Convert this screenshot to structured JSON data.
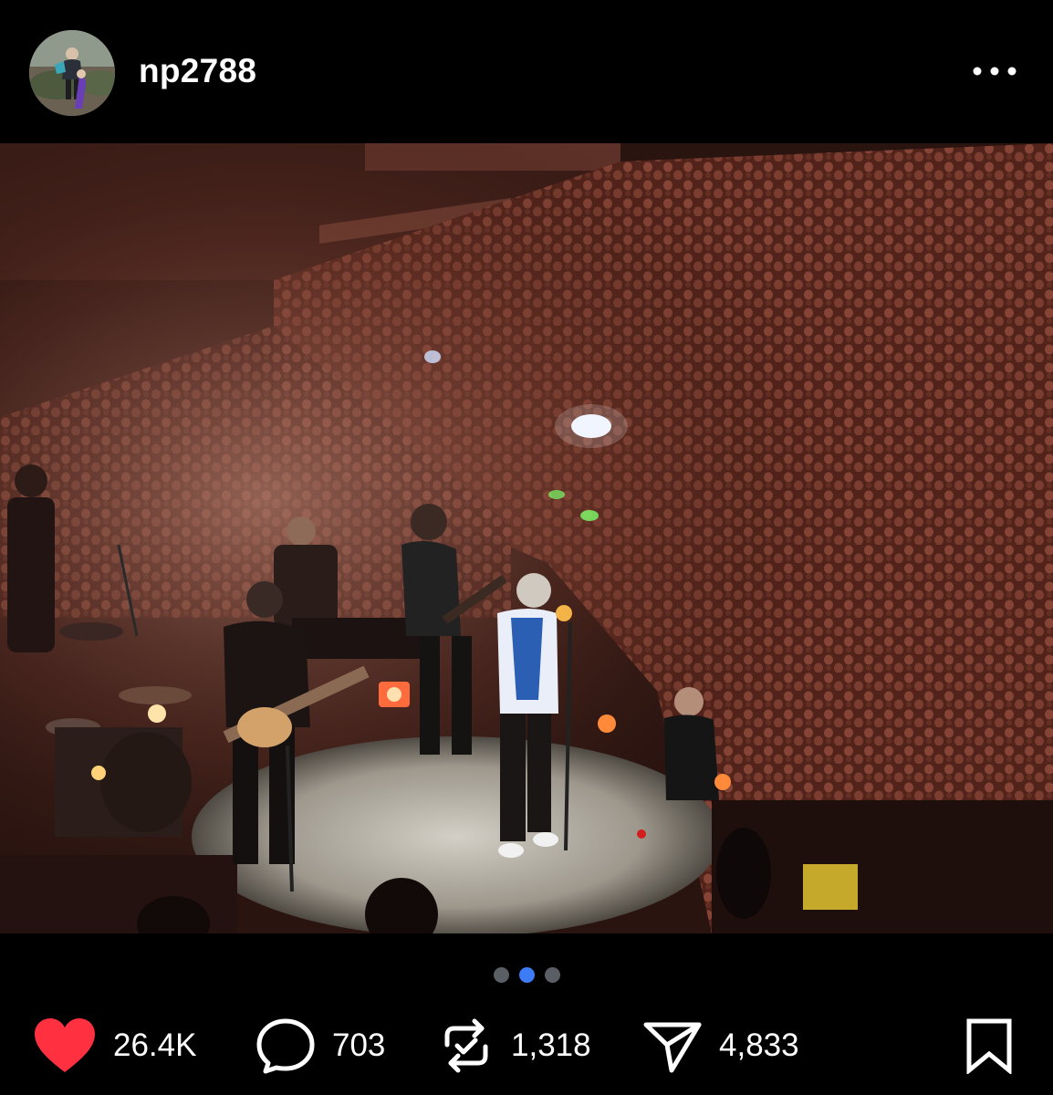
{
  "post": {
    "username": "np2788",
    "carousel": {
      "total": 3,
      "active_index": 1
    }
  },
  "icons": {
    "more": "more-horizontal-icon",
    "like": "heart-icon",
    "comment": "comment-bubble-icon",
    "repost": "repost-icon",
    "share": "send-icon",
    "save": "bookmark-icon"
  },
  "stats": {
    "likes": "26.4K",
    "comments": "703",
    "reposts": "1,318",
    "shares": "4,833"
  },
  "colors": {
    "like": "#ff3040",
    "active_dot": "#3d7cf7",
    "inactive_dot": "#5a5f66"
  }
}
